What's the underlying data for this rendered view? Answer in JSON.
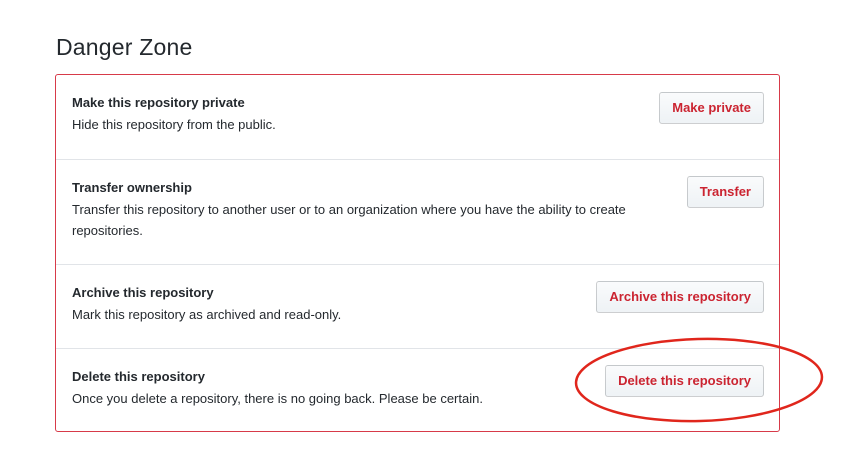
{
  "section": {
    "heading": "Danger Zone"
  },
  "rows": [
    {
      "title": "Make this repository private",
      "description": "Hide this repository from the public.",
      "button": "Make private"
    },
    {
      "title": "Transfer ownership",
      "description": "Transfer this repository to another user or to an organization where you have the ability to create repositories.",
      "button": "Transfer"
    },
    {
      "title": "Archive this repository",
      "description": "Mark this repository as archived and read-only.",
      "button": "Archive this repository"
    },
    {
      "title": "Delete this repository",
      "description": "Once you delete a repository, there is no going back. Please be certain.",
      "button": "Delete this repository"
    }
  ],
  "colors": {
    "danger": "#d73a49",
    "button_text": "#cb2431",
    "annotation": "#e0261c"
  }
}
